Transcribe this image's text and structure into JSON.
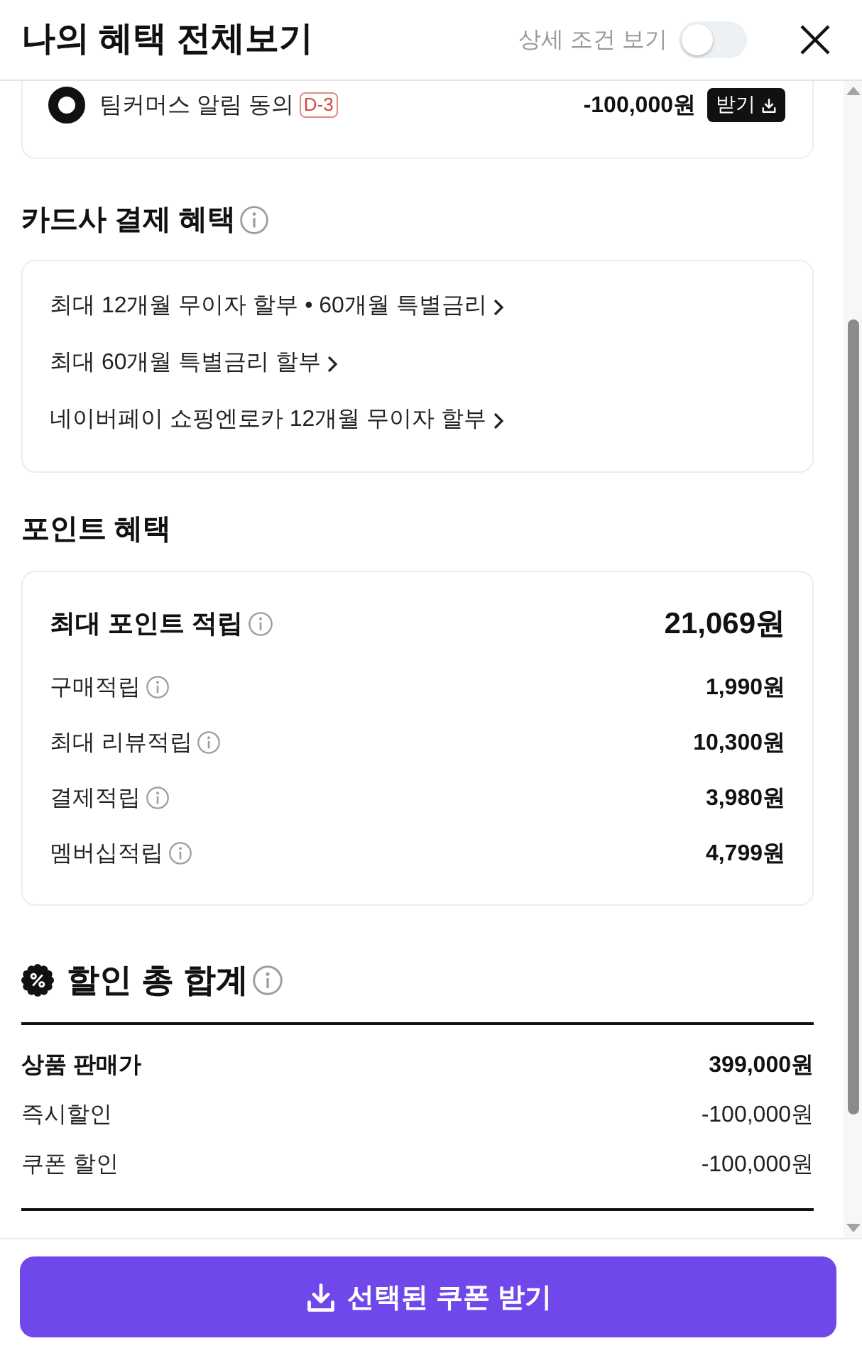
{
  "header": {
    "title": "나의 혜택 전체보기",
    "detail_toggle": {
      "label": "상세 조건 보기",
      "on": false
    }
  },
  "coupons": [
    {
      "selected": true,
      "name": "팀커머스 알림 동의",
      "badge": "D-3",
      "amount": "-100,000원",
      "button": "받기"
    }
  ],
  "card_benefits": {
    "title": "카드사 결제 혜택",
    "links": [
      "최대 12개월 무이자 할부 • 60개월 특별금리",
      "최대 60개월 특별금리 할부",
      "네이버페이 쇼핑엔로카 12개월 무이자 할부"
    ]
  },
  "point_benefits": {
    "title": "포인트 혜택",
    "total": {
      "label": "최대 포인트 적립",
      "value": "21,069원"
    },
    "items": [
      {
        "label": "구매적립",
        "value": "1,990원"
      },
      {
        "label": "최대 리뷰적립",
        "value": "10,300원"
      },
      {
        "label": "결제적립",
        "value": "3,980원"
      },
      {
        "label": "멤버십적립",
        "value": "4,799원"
      }
    ]
  },
  "discount_total": {
    "title": "할인 총 합계",
    "rows": [
      {
        "kind": "subtotal",
        "label": "상품 판매가",
        "value": "399,000원"
      },
      {
        "kind": "discount",
        "label": "즉시할인",
        "value": "-100,000원"
      },
      {
        "kind": "discount",
        "label": "쿠폰 할인",
        "value": "-100,000원"
      }
    ]
  },
  "footer_button": "선택된 쿠폰 받기"
}
